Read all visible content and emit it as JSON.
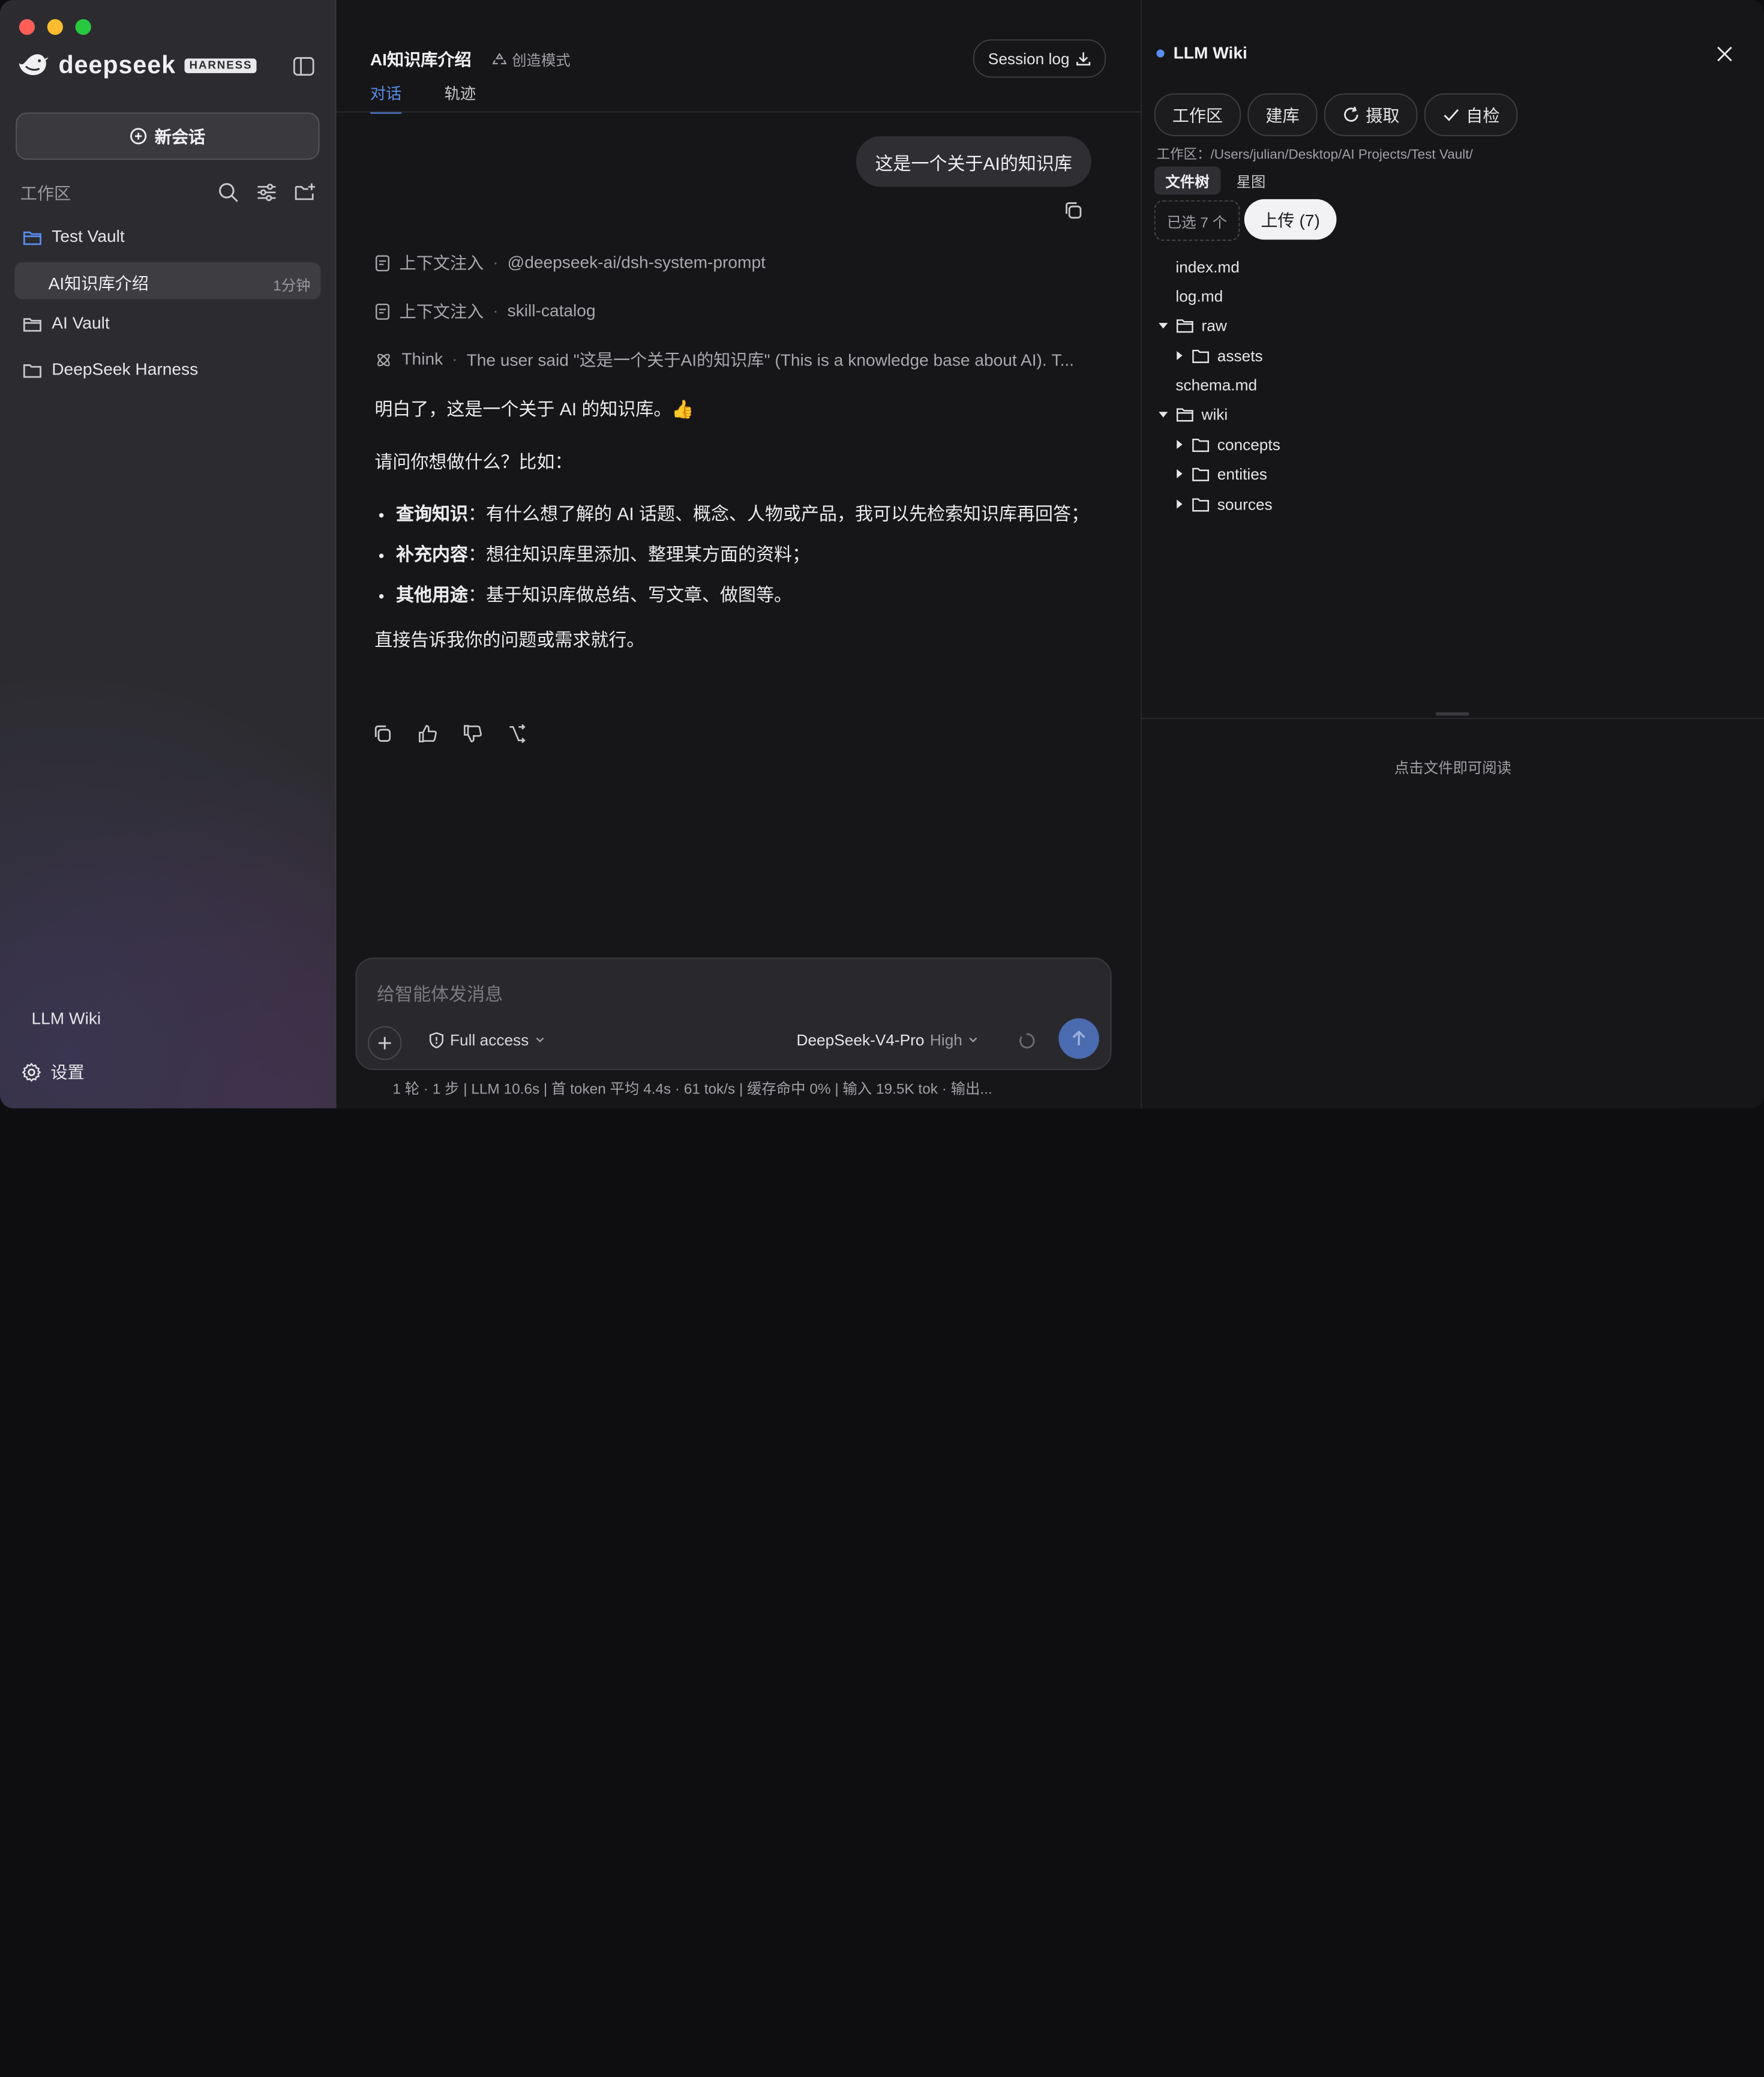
{
  "sidebar": {
    "brand": "deepseek",
    "brand_tag": "HARNESS",
    "new_chat": "新会话",
    "workspace_label": "工作区",
    "vaults": [
      {
        "name": "Test Vault"
      },
      {
        "name": "AI Vault"
      },
      {
        "name": "DeepSeek Harness"
      }
    ],
    "session": {
      "title": "AI知识库介绍",
      "time": "1分钟"
    },
    "footer_link": "LLM Wiki",
    "settings": "设置"
  },
  "header": {
    "title": "AI知识库介绍",
    "mode": "创造模式",
    "session_log": "Session log",
    "tabs": [
      "对话",
      "轨迹"
    ],
    "active_tab": "对话"
  },
  "chat": {
    "user_message": "这是一个关于AI的知识库",
    "steps": [
      {
        "label": "上下文注入",
        "detail": "@deepseek-ai/dsh-system-prompt"
      },
      {
        "label": "上下文注入",
        "detail": "skill-catalog"
      },
      {
        "label": "Think",
        "detail": "The user said \"这是一个关于AI的知识库\" (This is a knowledge base about AI). T..."
      }
    ],
    "answer": {
      "p1": "明白了，这是一个关于 AI 的知识库。👍",
      "p2": "请问你想做什么？比如：",
      "bullets": [
        {
          "bold": "查询知识",
          "text": "：有什么想了解的 AI 话题、概念、人物或产品，我可以先检索知识库再回答；"
        },
        {
          "bold": "补充内容",
          "text": "：想往知识库里添加、整理某方面的资料；"
        },
        {
          "bold": "其他用途",
          "text": "：基于知识库做总结、写文章、做图等。"
        }
      ],
      "p3": "直接告诉我你的问题或需求就行。"
    }
  },
  "composer": {
    "placeholder": "给智能体发消息",
    "access": "Full access",
    "model": "DeepSeek-V4-Pro",
    "level": "High"
  },
  "status_bar": "1 轮 · 1 步   |   LLM 10.6s   |   首 token 平均 4.4s · 61 tok/s   |   缓存命中 0%   |   输入 19.5K tok · 输出...",
  "wiki": {
    "title": "LLM Wiki",
    "buttons": [
      "工作区",
      "建库",
      "摄取",
      "自检"
    ],
    "path": "工作区：/Users/julian/Desktop/AI Projects/Test Vault/",
    "tabs": [
      "文件树",
      "星图"
    ],
    "active_tab": "文件树",
    "selected": "已选 7 个",
    "upload": "上传 (7)",
    "files": {
      "index": "index.md",
      "log": "log.md",
      "raw": "raw",
      "assets": "assets",
      "schema": "schema.md",
      "wiki": "wiki",
      "concepts": "concepts",
      "entities": "entities",
      "sources": "sources"
    },
    "hint": "点击文件即可阅读"
  },
  "colors": {
    "accent": "#5a8dee",
    "traffic_red": "#ff5f57",
    "traffic_yellow": "#febc2e",
    "traffic_green": "#28c840"
  }
}
